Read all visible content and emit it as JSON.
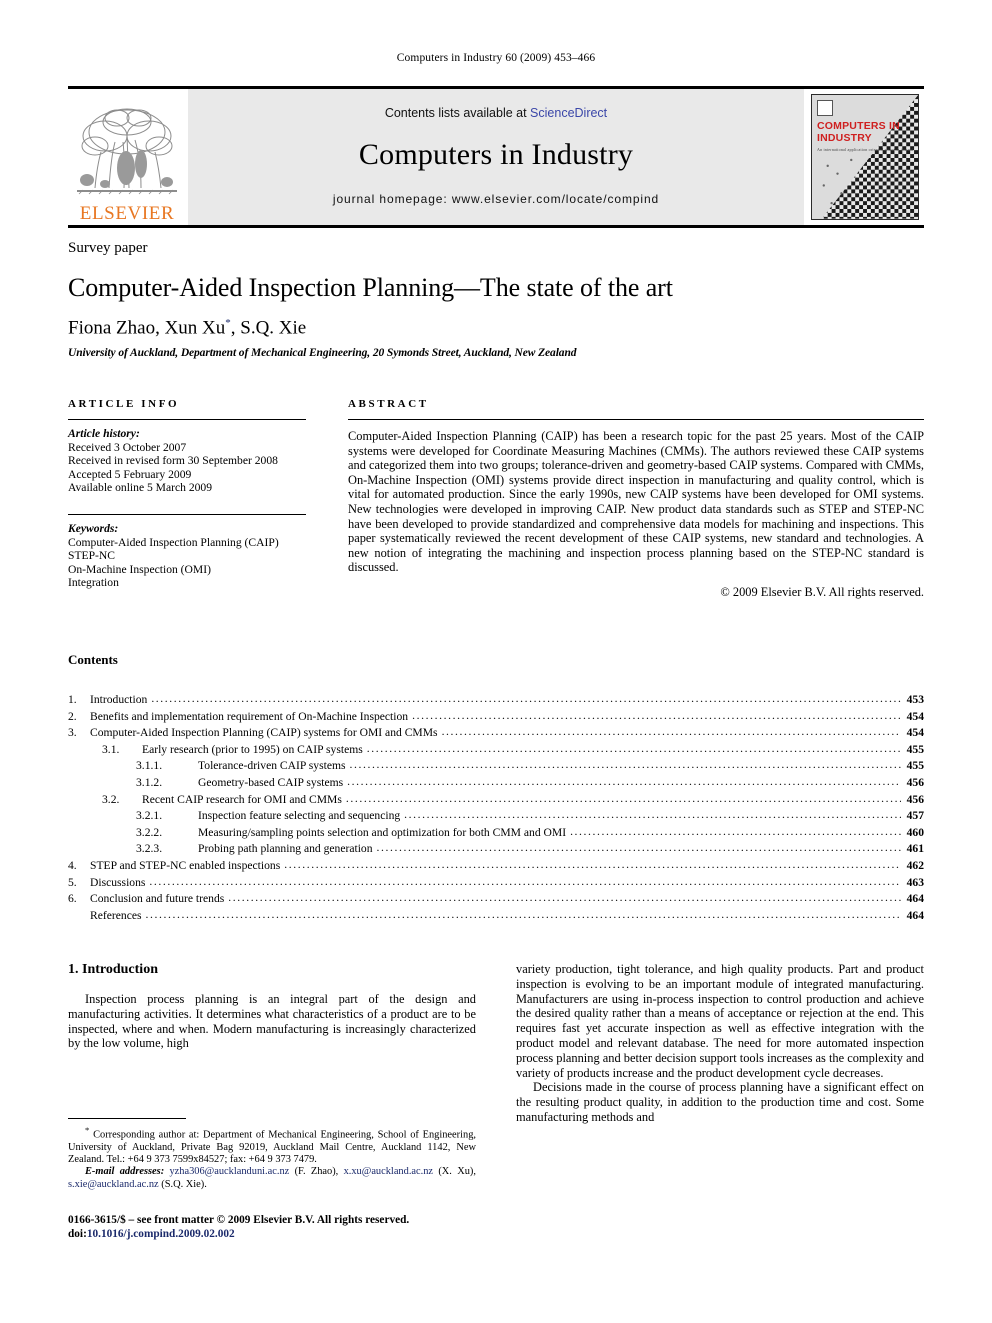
{
  "running_head": "Computers in Industry 60 (2009) 453–466",
  "masthead": {
    "publisher_logo_name": "ELSEVIER",
    "contents_available_prefix": "Contents lists available at ",
    "sciencedirect_label": "ScienceDirect",
    "journal_name": "Computers in Industry",
    "journal_homepage": "journal homepage: www.elsevier.com/locate/compind",
    "cover": {
      "title_line1": "COMPUTERS IN",
      "title_line2": "INDUSTRY",
      "subtitle": "An international application oriented research journal",
      "title_color": "#cf2020"
    },
    "accent_orange": "#E87722",
    "link_blue": "#3a46a8"
  },
  "article": {
    "type": "Survey paper",
    "title": "Computer-Aided Inspection Planning—The state of the art",
    "authors": "Fiona Zhao, Xun Xu",
    "corresponding_marker": "*",
    "authors_tail": ", S.Q. Xie",
    "affiliation": "University of Auckland, Department of Mechanical Engineering, 20 Symonds Street, Auckland, New Zealand"
  },
  "article_info": {
    "label": "ARTICLE INFO",
    "history_title": "Article history:",
    "history": [
      "Received 3 October 2007",
      "Received in revised form 30 September 2008",
      "Accepted 5 February 2009",
      "Available online 5 March 2009"
    ],
    "keywords_title": "Keywords:",
    "keywords": [
      "Computer-Aided Inspection Planning (CAIP)",
      "STEP-NC",
      "On-Machine Inspection (OMI)",
      "Integration"
    ]
  },
  "abstract": {
    "label": "ABSTRACT",
    "text": "Computer-Aided Inspection Planning (CAIP) has been a research topic for the past 25 years. Most of the CAIP systems were developed for Coordinate Measuring Machines (CMMs). The authors reviewed these CAIP systems and categorized them into two groups; tolerance-driven and geometry-based CAIP systems. Compared with CMMs, On-Machine Inspection (OMI) systems provide direct inspection in manufacturing and quality control, which is vital for automated production. Since the early 1990s, new CAIP systems have been developed for OMI systems. New technologies were developed in improving CAIP. New product data standards such as STEP and STEP-NC have been developed to provide standardized and comprehensive data models for machining and inspections. This paper systematically reviewed the recent development of these CAIP systems, new standard and technologies. A new notion of integrating the machining and inspection process planning based on the STEP-NC standard is discussed.",
    "copyright": "© 2009 Elsevier B.V. All rights reserved."
  },
  "contents": {
    "heading": "Contents",
    "entries": [
      {
        "level": 1,
        "num": "1.",
        "text": "Introduction",
        "page": "453"
      },
      {
        "level": 1,
        "num": "2.",
        "text": "Benefits and implementation requirement of On-Machine Inspection",
        "page": "454"
      },
      {
        "level": 1,
        "num": "3.",
        "text": "Computer-Aided Inspection Planning (CAIP) systems for OMI and CMMs",
        "page": "454"
      },
      {
        "level": 2,
        "num": "3.1.",
        "text": "Early research (prior to 1995) on CAIP systems",
        "page": "455"
      },
      {
        "level": 3,
        "num": "3.1.1.",
        "text": "Tolerance-driven CAIP systems",
        "page": "455"
      },
      {
        "level": 3,
        "num": "3.1.2.",
        "text": "Geometry-based CAIP systems",
        "page": "456"
      },
      {
        "level": 2,
        "num": "3.2.",
        "text": "Recent CAIP research for OMI and CMMs",
        "page": "456"
      },
      {
        "level": 3,
        "num": "3.2.1.",
        "text": "Inspection feature selecting and sequencing",
        "page": "457"
      },
      {
        "level": 3,
        "num": "3.2.2.",
        "text": "Measuring/sampling points selection and optimization for both CMM and OMI",
        "page": "460"
      },
      {
        "level": 3,
        "num": "3.2.3.",
        "text": "Probing path planning and generation",
        "page": "461"
      },
      {
        "level": 1,
        "num": "4.",
        "text": "STEP and STEP-NC enabled inspections",
        "page": "462"
      },
      {
        "level": 1,
        "num": "5.",
        "text": "Discussions",
        "page": "463"
      },
      {
        "level": 1,
        "num": "6.",
        "text": "Conclusion and future trends",
        "page": "464"
      },
      {
        "level": 0,
        "num": "",
        "text": "References",
        "page": "464"
      }
    ]
  },
  "introduction": {
    "heading": "1. Introduction",
    "left_para1": "Inspection process planning is an integral part of the design and manufacturing activities. It determines what characteristics of a product are to be inspected, where and when. Modern manufacturing is increasingly characterized by the low volume, high",
    "right_para1_cont": "variety production, tight tolerance, and high quality products. Part and product inspection is evolving to be an important module of integrated manufacturing. Manufacturers are using in-process inspection to control production and achieve the desired quality rather than a means of acceptance or rejection at the end. This requires fast yet accurate inspection as well as effective integration with the product model and relevant database. The need for more automated inspection process planning and better decision support tools increases as the complexity and variety of products increase and the product development cycle decreases.",
    "right_para2": "Decisions made in the course of process planning have a significant effect on the resulting product quality, in addition to the production time and cost. Some manufacturing methods and"
  },
  "footnote": {
    "corresponding_marker": "*",
    "corresponding_text": "Corresponding author at: Department of Mechanical Engineering, School of Engineering, University of Auckland, Private Bag 92019, Auckland Mail Centre, Auckland 1142, New Zealand. Tel.: +64 9 373 7599x84527; fax: +64 9 373 7479.",
    "email_label": "E-mail addresses:",
    "emails": [
      {
        "address": "yzha306@aucklanduni.ac.nz",
        "owner": "(F. Zhao)"
      },
      {
        "address": "x.xu@auckland.ac.nz",
        "owner": "(X. Xu)"
      },
      {
        "address": "s.xie@auckland.ac.nz",
        "owner": "(S.Q. Xie)"
      }
    ]
  },
  "imprint": {
    "issn_line": "0166-3615/$ – see front matter © 2009 Elsevier B.V. All rights reserved.",
    "doi_prefix": "doi:",
    "doi": "10.1016/j.compind.2009.02.002"
  }
}
